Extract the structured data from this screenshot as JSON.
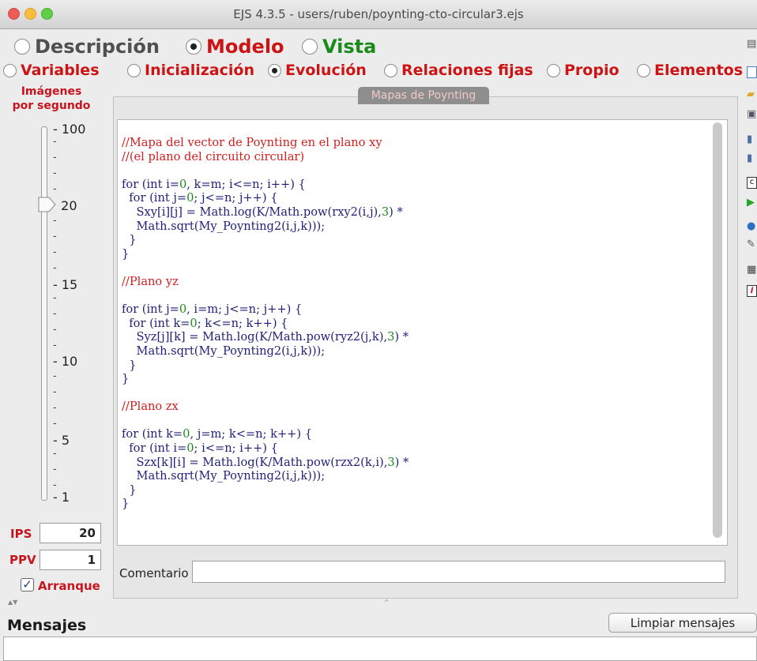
{
  "window": {
    "title": "EJS 4.3.5 - users/ruben/poynting-cto-circular3.ejs"
  },
  "main_tabs": [
    {
      "label": "Descripción",
      "selected": false
    },
    {
      "label": "Modelo",
      "selected": true,
      "color": "#cc1414"
    },
    {
      "label": "Vista",
      "selected": false,
      "color": "#1a8a1a"
    }
  ],
  "sub_tabs": [
    {
      "label": "Variables",
      "selected": false
    },
    {
      "label": "Inicialización",
      "selected": false
    },
    {
      "label": "Evolución",
      "selected": true
    },
    {
      "label": "Relaciones fijas",
      "selected": false
    },
    {
      "label": "Propio",
      "selected": false
    },
    {
      "label": "Elementos",
      "selected": false
    }
  ],
  "fps_panel": {
    "label_line1": "Imágenes",
    "label_line2": "por segundo",
    "ticks": [
      "100",
      "20",
      "15",
      "10",
      "5",
      "1"
    ],
    "ips_label": "IPS",
    "ips_value": "20",
    "ppv_label": "PPV",
    "ppv_value": "1",
    "autostart_label": "Arranque",
    "autostart_checked": true
  },
  "editor": {
    "page_tab": "Mapas de Poynting",
    "code_lines": [
      "//Mapa del vector de Poynting en el plano xy",
      "//(el plano del circuito circular)",
      "",
      "for (int i=0, k=m; i<=n; i++) {",
      "  for (int j=0; j<=n; j++) {",
      "    Sxy[i][j] = Math.log(K/Math.pow(rxy2(i,j),3) *",
      "    Math.sqrt(My_Poynting2(i,j,k)));",
      "  }",
      "}",
      "",
      "//Plano yz",
      "",
      "for (int j=0, i=m; j<=n; j++) {",
      "  for (int k=0; k<=n; k++) {",
      "    Syz[j][k] = Math.log(K/Math.pow(ryz2(j,k),3) *",
      "    Math.sqrt(My_Poynting2(i,j,k)));",
      "  }",
      "}",
      "",
      "//Plano zx",
      "",
      "for (int k=0, j=m; k<=n; k++) {",
      "  for (int i=0; i<=n; i++) {",
      "    Szx[k][i] = Math.log(K/Math.pow(rzx2(k,i),3) *",
      "    Math.sqrt(My_Poynting2(i,j,k)));",
      "  }",
      "}"
    ],
    "comment_label": "Comentario",
    "comment_value": ""
  },
  "messages": {
    "label": "Mensajes",
    "clear_button": "Limpiar mensajes"
  },
  "toolbar_icons": [
    "list-icon",
    "new-file-icon",
    "open-folder-icon",
    "browse-icon",
    "save-icon",
    "save-as-icon",
    "search-icon",
    "run-icon",
    "globe-icon",
    "tools-icon",
    "clipboard-icon",
    "info-icon"
  ]
}
